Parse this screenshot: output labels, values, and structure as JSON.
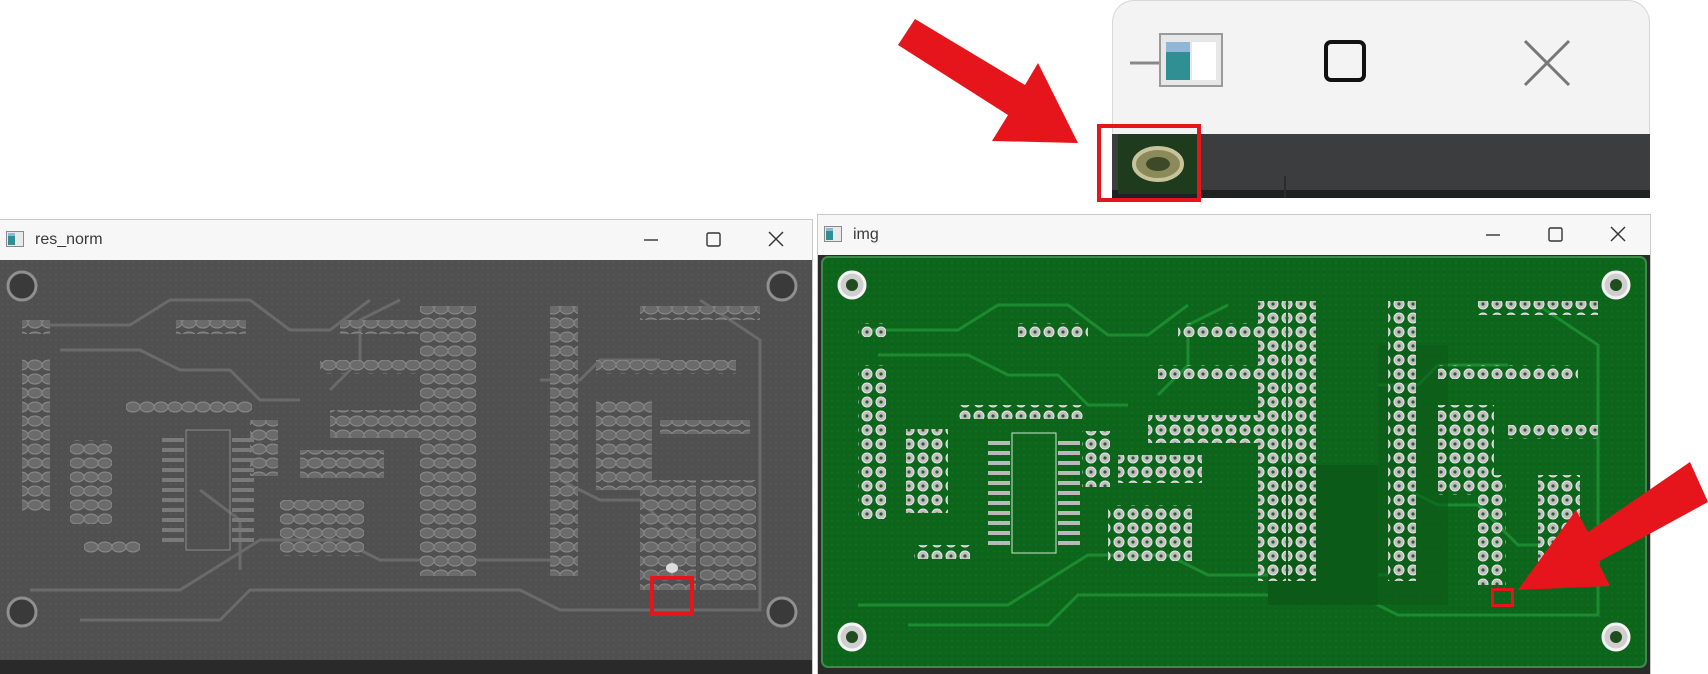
{
  "windows": {
    "res_norm": {
      "title": "res_norm"
    },
    "img": {
      "title": "img"
    }
  },
  "icons": {
    "minimize": "minimize-icon",
    "maximize": "maximize-icon",
    "close": "close-icon",
    "window_app": "opencv-window-icon",
    "arrow": "red-arrow-icon"
  },
  "colors": {
    "annotation_red": "#e5151b",
    "pcb_green": "#0f6b1e",
    "pcb_gray": "#555555"
  }
}
